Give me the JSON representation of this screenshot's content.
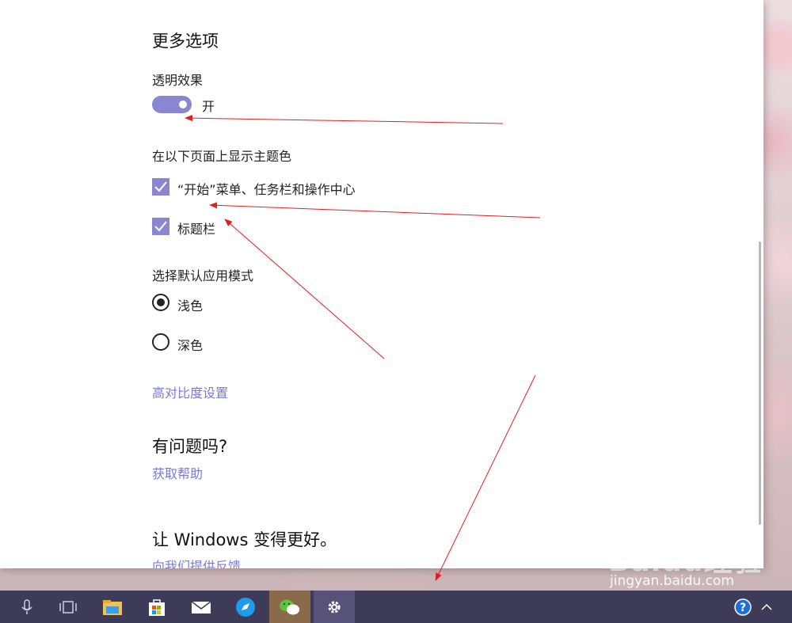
{
  "settings": {
    "more_options_title": "更多选项",
    "transparency_label": "透明效果",
    "transparency_state": "开",
    "accent_surfaces_label": "在以下页面上显示主题色",
    "checkbox_start_taskbar": "“开始”菜单、任务栏和操作中心",
    "checkbox_title_bars": "标题栏",
    "app_mode_label": "选择默认应用模式",
    "radio_light": "浅色",
    "radio_dark": "深色",
    "high_contrast_link": "高对比度设置",
    "question_title": "有问题吗?",
    "get_help_link": "获取帮助",
    "feedback_title": "让 Windows 变得更好。",
    "feedback_link": "向我们提供反馈"
  },
  "state": {
    "transparency_on": true,
    "start_taskbar_checked": true,
    "title_bars_checked": true,
    "app_mode_selected": "浅色"
  },
  "colors": {
    "accent": "#8b86d2",
    "link": "#7a7ad6",
    "taskbar": "#3d3b58",
    "annotation_arrow": "#e02020"
  },
  "watermark": {
    "brand": "Baidu经验",
    "url": "jingyan.baidu.com"
  },
  "taskbar": {
    "icons": [
      "microphone-icon",
      "task-view-icon",
      "file-explorer-icon",
      "store-icon",
      "mail-icon",
      "browser-icon",
      "wechat-icon",
      "settings-gear-icon"
    ],
    "tray_icons": [
      "help-icon",
      "chevron-up-icon"
    ]
  }
}
